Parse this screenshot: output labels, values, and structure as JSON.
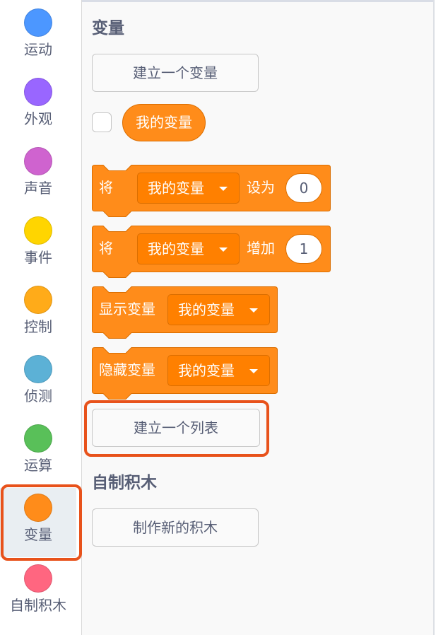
{
  "categories": [
    {
      "label": "运动",
      "color": "#4c97ff"
    },
    {
      "label": "外观",
      "color": "#9966ff"
    },
    {
      "label": "声音",
      "color": "#cf63cf"
    },
    {
      "label": "事件",
      "color": "#ffd500"
    },
    {
      "label": "控制",
      "color": "#ffab19"
    },
    {
      "label": "侦测",
      "color": "#5cb1d6"
    },
    {
      "label": "运算",
      "color": "#59c059"
    },
    {
      "label": "变量",
      "color": "#ff8c1a"
    },
    {
      "label": "自制积木",
      "color": "#ff6680"
    }
  ],
  "palette": {
    "variables_title": "变量",
    "make_variable_label": "建立一个变量",
    "variable_reporter": "我的变量",
    "set_block": {
      "prefix": "将",
      "dropdown": "我的变量",
      "middle": "设为",
      "value": "0"
    },
    "change_block": {
      "prefix": "将",
      "dropdown": "我的变量",
      "middle": "增加",
      "value": "1"
    },
    "show_block": {
      "prefix": "显示变量",
      "dropdown": "我的变量"
    },
    "hide_block": {
      "prefix": "隐藏变量",
      "dropdown": "我的变量"
    },
    "make_list_label": "建立一个列表",
    "my_blocks_title": "自制积木",
    "make_block_label": "制作新的积木"
  },
  "colors": {
    "block": "#ff8c1a",
    "block_border": "#db6e00",
    "highlight": "#e8521b"
  },
  "icons": {
    "dropdown_arrow": "triangle-down-icon"
  }
}
